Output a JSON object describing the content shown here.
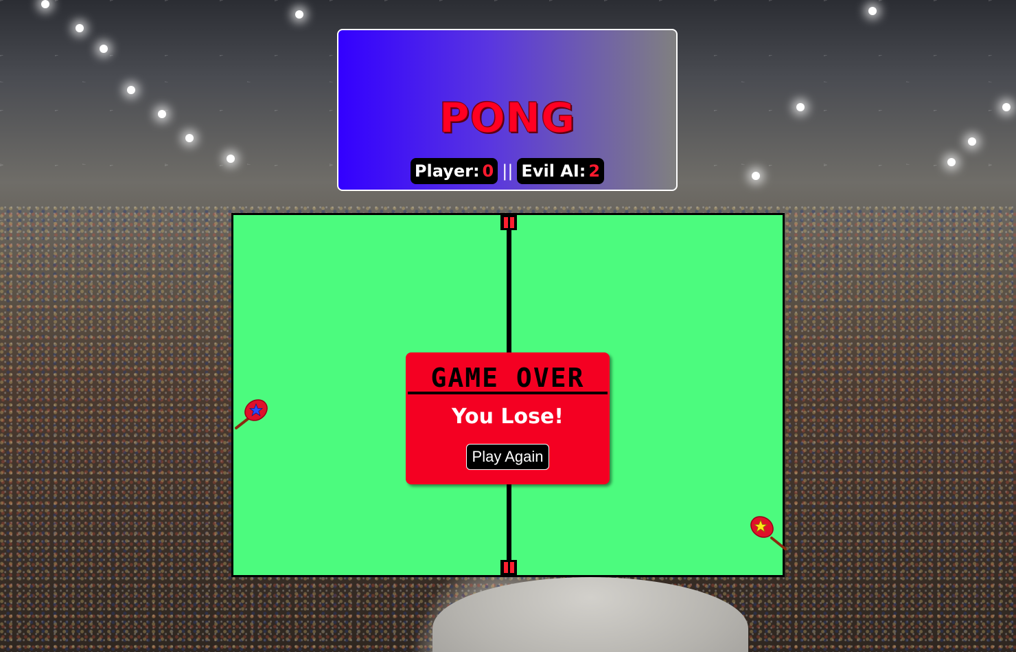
{
  "header": {
    "title": "PONG",
    "player_label": "Player:",
    "player_score": "0",
    "separator": "||",
    "ai_label": "Evil AI:",
    "ai_score": "2"
  },
  "game_over": {
    "title": "GAME OVER",
    "message": "You Lose!",
    "button_label": "Play Again"
  },
  "colors": {
    "court": "#4cfb7e",
    "modal": "#f40022",
    "title": "#ff0022",
    "header_gradient_start": "#3300ff",
    "header_gradient_end": "#808080"
  },
  "icons": {
    "player_paddle": "ping-pong-paddle-blue-star-icon",
    "ai_paddle": "ping-pong-paddle-yellow-star-icon"
  }
}
